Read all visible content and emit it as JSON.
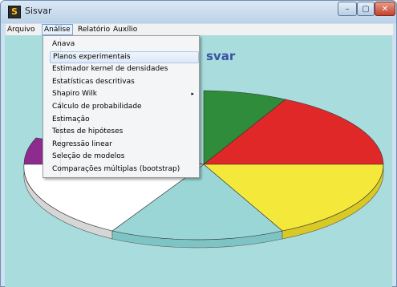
{
  "window": {
    "title": "Sisvar",
    "icon_letter": "S",
    "min": "–",
    "max": "▢",
    "close": "✕"
  },
  "menubar": [
    {
      "label": "Arquivo"
    },
    {
      "label": "Análise"
    },
    {
      "label": "Relatório"
    },
    {
      "label": "Auxílio"
    }
  ],
  "dropdown": {
    "items": [
      {
        "label": "Anava"
      },
      {
        "label": "Planos experimentais"
      },
      {
        "label": "Estimador kernel de densidades"
      },
      {
        "label": "Estatísticas descritivas"
      },
      {
        "label": "Shapiro Wilk",
        "submenu_arrow": "▸"
      },
      {
        "label": "Cálculo de probabilidade"
      },
      {
        "label": "Estimação"
      },
      {
        "label": "Testes de hipóteses"
      },
      {
        "label": "Regressão linear"
      },
      {
        "label": "Seleção de modelos"
      },
      {
        "label": "Comparações múltiplas (bootstrap)"
      }
    ]
  },
  "chart": {
    "title_fragment": "svar",
    "colors": {
      "purple": "#8e2b8f",
      "green": "#2f8c3a",
      "red": "#e02828",
      "yellow": "#f4e83a",
      "cyan": "#9bd6d6",
      "white": "#ffffff",
      "bg": "#a9dcdc"
    }
  }
}
